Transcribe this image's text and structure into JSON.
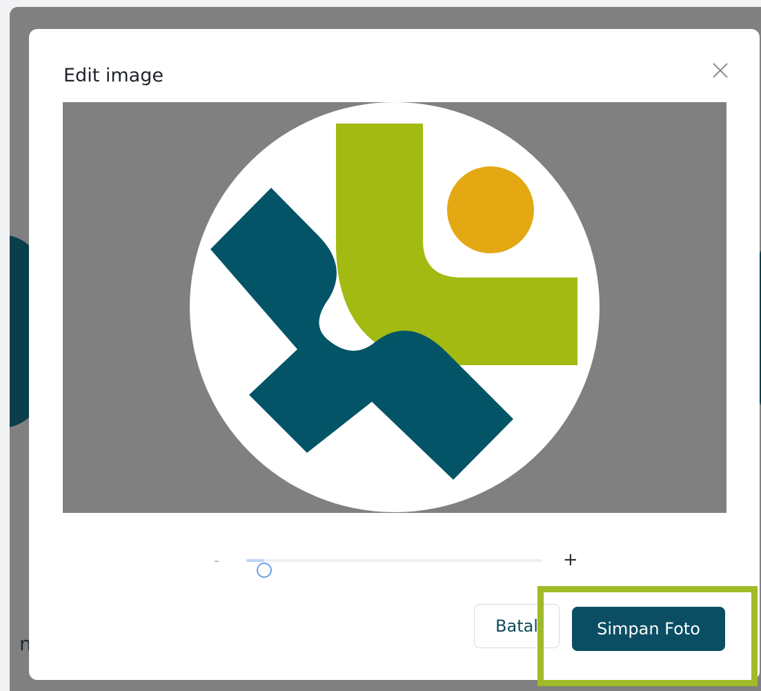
{
  "modal": {
    "title": "Edit image",
    "close_icon": "close-icon"
  },
  "zoom": {
    "minus_label": "-",
    "plus_label": "+",
    "value": 0.06
  },
  "buttons": {
    "cancel_label": "Batal",
    "save_label": "Simpan Foto"
  },
  "background": {
    "text_fragment": "n"
  },
  "colors": {
    "primary": "#0b4e63",
    "logo_teal": "#045468",
    "logo_green": "#a2ba12",
    "logo_orange": "#e3a812",
    "highlight": "#9fbb28"
  }
}
